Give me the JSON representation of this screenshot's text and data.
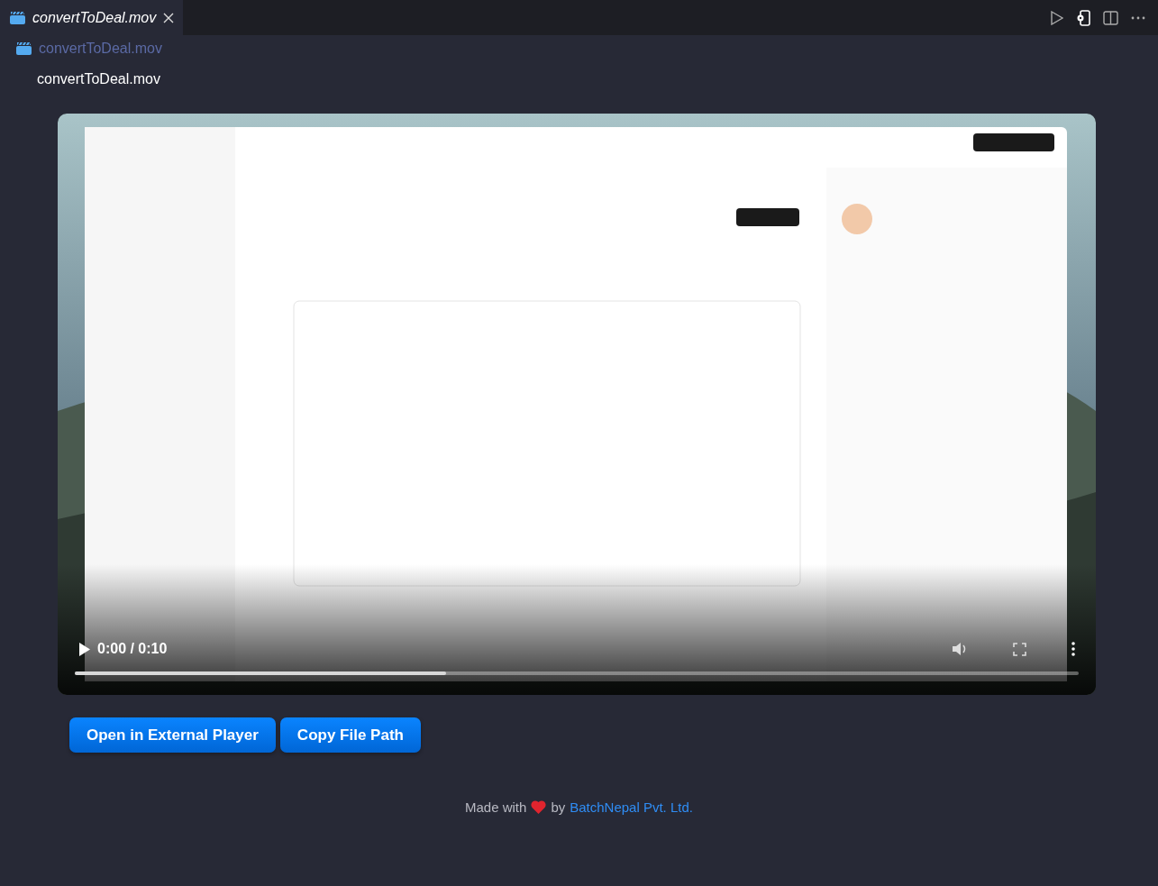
{
  "tab": {
    "title": "convertToDeal.mov",
    "selected": true
  },
  "breadcrumb": "convertToDeal.mov",
  "heading": "convertToDeal.mov",
  "video": {
    "kind": "picture",
    "playing": false,
    "time": "0:00 / 0:10",
    "level": 0.37
  },
  "buttons": [
    "Open in External Player",
    "Copy File Path"
  ],
  "footer": {
    "prefix": "Made with",
    "middle": "by",
    "link": "BatchNepal Pvt. Ltd."
  }
}
